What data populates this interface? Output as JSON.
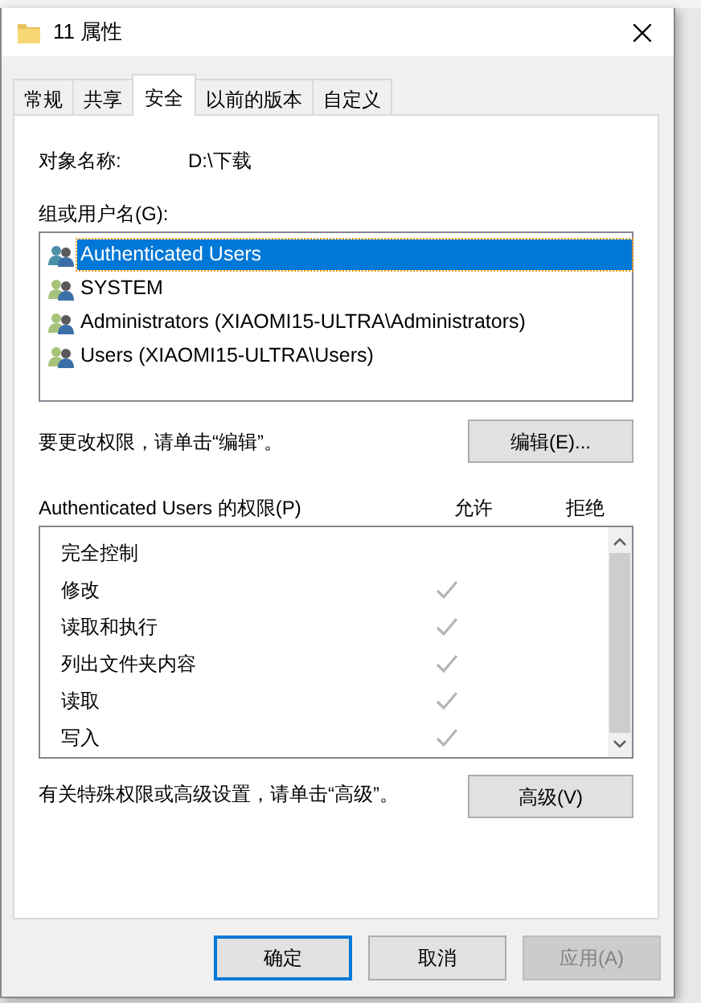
{
  "window": {
    "title": "11 属性"
  },
  "tabs": [
    {
      "label": "常规",
      "selected": false
    },
    {
      "label": "共享",
      "selected": false
    },
    {
      "label": "安全",
      "selected": true
    },
    {
      "label": "以前的版本",
      "selected": false
    },
    {
      "label": "自定义",
      "selected": false
    }
  ],
  "object_name": {
    "label": "对象名称:",
    "value": "D:\\下载"
  },
  "groups": {
    "label": "组或用户名(G):",
    "items": [
      {
        "name": "Authenticated Users",
        "selected": true
      },
      {
        "name": "SYSTEM",
        "selected": false
      },
      {
        "name": "Administrators (XIAOMI15-ULTRA\\Administrators)",
        "selected": false
      },
      {
        "name": "Users (XIAOMI15-ULTRA\\Users)",
        "selected": false
      }
    ]
  },
  "edit_hint": "要更改权限，请单击“编辑”。",
  "edit_button": "编辑(E)...",
  "permissions": {
    "label": "Authenticated Users 的权限(P)",
    "allow_header": "允许",
    "deny_header": "拒绝",
    "rows": [
      {
        "name": "完全控制",
        "allow": false,
        "deny": false
      },
      {
        "name": "修改",
        "allow": true,
        "deny": false
      },
      {
        "name": "读取和执行",
        "allow": true,
        "deny": false
      },
      {
        "name": "列出文件夹内容",
        "allow": true,
        "deny": false
      },
      {
        "name": "读取",
        "allow": true,
        "deny": false
      },
      {
        "name": "写入",
        "allow": true,
        "deny": false
      }
    ]
  },
  "advanced_hint": "有关特殊权限或高级设置，请单击“高级”。",
  "advanced_button": "高级(V)",
  "buttons": [
    {
      "label": "确定",
      "kind": "default"
    },
    {
      "label": "取消",
      "kind": "normal"
    },
    {
      "label": "应用(A)",
      "kind": "disabled"
    }
  ]
}
